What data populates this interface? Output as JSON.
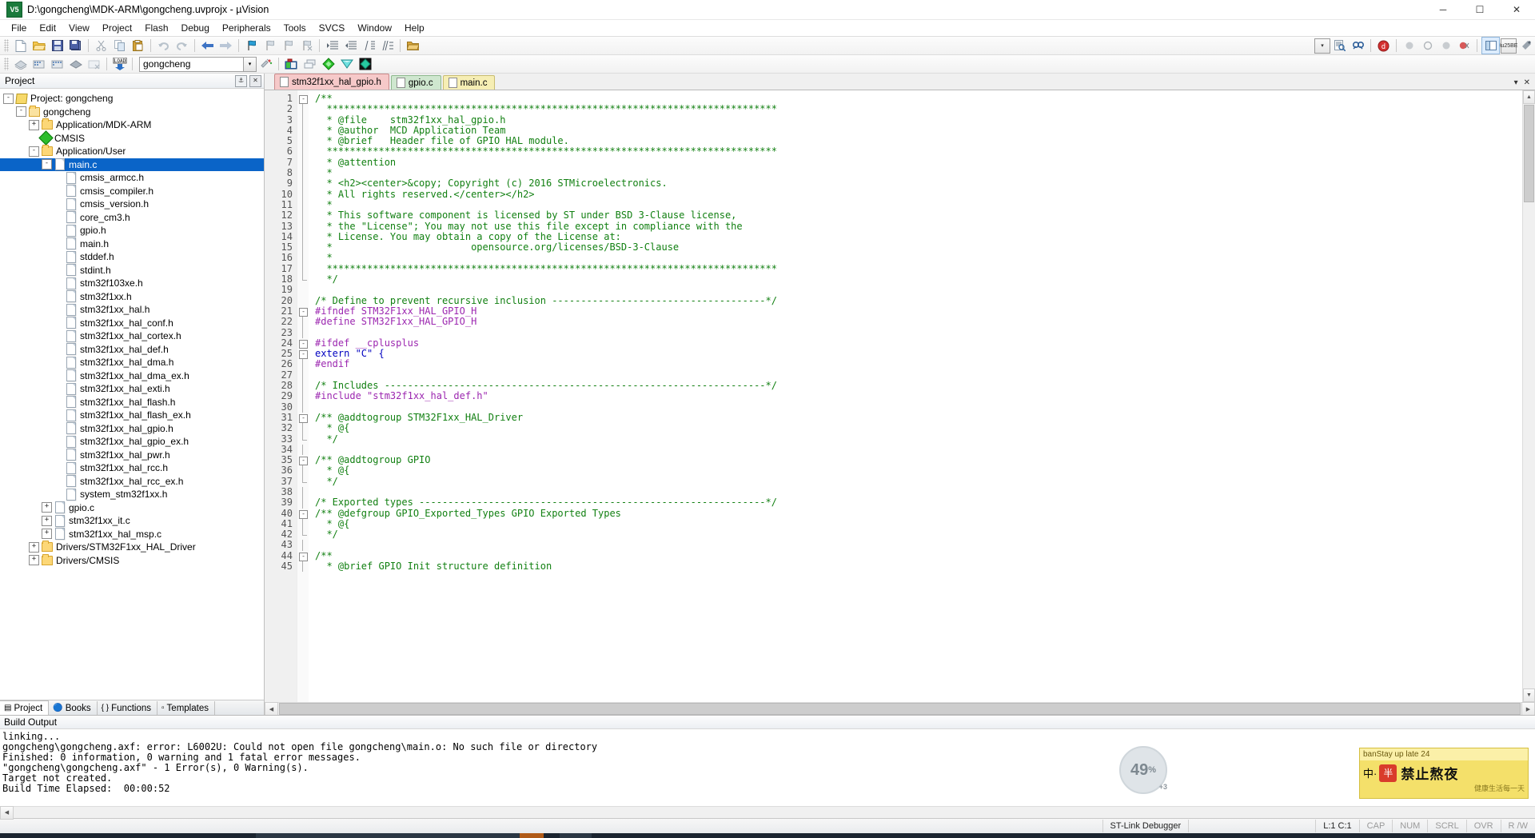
{
  "window": {
    "title": "D:\\gongcheng\\MDK-ARM\\gongcheng.uvprojx - µVision",
    "app_icon_text": "V5",
    "minimize": "─",
    "maximize": "☐",
    "close": "✕"
  },
  "menu": [
    "File",
    "Edit",
    "View",
    "Project",
    "Flash",
    "Debug",
    "Peripherals",
    "Tools",
    "SVCS",
    "Window",
    "Help"
  ],
  "toolbar_main": [
    {
      "name": "new-file-icon",
      "glyph": "📄"
    },
    {
      "name": "open-file-icon",
      "glyph": "📂"
    },
    {
      "name": "save-icon",
      "glyph": "💾"
    },
    {
      "name": "save-all-icon",
      "glyph": "🖫"
    },
    {
      "name": "cut-icon",
      "glyph": "✂"
    },
    {
      "name": "copy-icon",
      "glyph": "⧉"
    },
    {
      "name": "paste-icon",
      "glyph": "📋"
    },
    {
      "name": "undo-icon",
      "glyph": "↶"
    },
    {
      "name": "redo-icon",
      "glyph": "↷"
    },
    {
      "name": "navigate-back-icon",
      "glyph": "←"
    },
    {
      "name": "navigate-forward-icon",
      "glyph": "→"
    },
    {
      "name": "bookmark-toggle-icon",
      "glyph": "⚑"
    },
    {
      "name": "bookmark-prev-icon",
      "glyph": "⚑"
    },
    {
      "name": "bookmark-next-icon",
      "glyph": "⚑"
    },
    {
      "name": "bookmark-clear-icon",
      "glyph": "⚑"
    },
    {
      "name": "indent-right-icon",
      "glyph": "≡"
    },
    {
      "name": "indent-left-icon",
      "glyph": "≡"
    },
    {
      "name": "comment-lines-icon",
      "glyph": "⫽"
    },
    {
      "name": "uncomment-lines-icon",
      "glyph": "⫽"
    },
    {
      "name": "open-folder-icon",
      "glyph": "📁"
    }
  ],
  "toolbar_main_right": [
    {
      "name": "find-combo-dropdown-icon",
      "glyph": "▾"
    },
    {
      "name": "find-in-files-icon",
      "glyph": "🔍"
    },
    {
      "name": "incremental-find-icon",
      "glyph": "🔎"
    },
    {
      "name": "debug-session-icon",
      "glyph": "ⓓ"
    },
    {
      "name": "insert-breakpoint-icon",
      "glyph": "⬤"
    },
    {
      "name": "disable-breakpoint-icon",
      "glyph": "○"
    },
    {
      "name": "disable-all-breakpoints-icon",
      "glyph": "⬤"
    },
    {
      "name": "kill-all-breakpoints-icon",
      "glyph": "⬤"
    },
    {
      "name": "window-layout-icon",
      "glyph": "▣"
    },
    {
      "name": "configuration-wizard-icon",
      "glyph": "🔧"
    }
  ],
  "toolbar_build": [
    {
      "name": "translate-file-icon",
      "glyph": "◆"
    },
    {
      "name": "build-target-icon",
      "glyph": "▓"
    },
    {
      "name": "rebuild-all-icon",
      "glyph": "▓"
    },
    {
      "name": "batch-build-icon",
      "glyph": "◆"
    },
    {
      "name": "stop-build-icon",
      "glyph": "░"
    },
    {
      "name": "download-to-flash-icon",
      "glyph": "LOAD"
    }
  ],
  "toolbar_build_right": [
    {
      "name": "target-options-icon",
      "glyph": "⚙"
    },
    {
      "name": "manage-project-items-icon",
      "glyph": "❖"
    },
    {
      "name": "multi-project-icon",
      "glyph": "❐"
    },
    {
      "name": "pack-installer-icon",
      "glyph": "◆"
    },
    {
      "name": "manage-run-time-env-icon",
      "glyph": "▽"
    },
    {
      "name": "select-software-packs-icon",
      "glyph": "◈"
    }
  ],
  "target_selector": {
    "value": "gongcheng",
    "dropdown_icon": "▾"
  },
  "project_panel": {
    "title": "Project",
    "pin_icon": "⚓",
    "close_icon": "✕",
    "tabs": [
      {
        "label": "Project",
        "icon": "▤",
        "active": true
      },
      {
        "label": "Books",
        "icon": "🔵",
        "active": false
      },
      {
        "label": "Functions",
        "icon": "{ }",
        "active": false
      },
      {
        "label": "Templates",
        "icon": "▫",
        "active": false
      }
    ],
    "tree": [
      {
        "label": "Project: gongcheng",
        "depth": 0,
        "toggle": "-",
        "icon": "project",
        "selected": false
      },
      {
        "label": "gongcheng",
        "depth": 1,
        "toggle": "-",
        "icon": "folder-target",
        "selected": false
      },
      {
        "label": "Application/MDK-ARM",
        "depth": 2,
        "toggle": "+",
        "icon": "folder",
        "selected": false
      },
      {
        "label": "CMSIS",
        "depth": 2,
        "toggle": "",
        "icon": "diamond",
        "selected": false
      },
      {
        "label": "Application/User",
        "depth": 2,
        "toggle": "-",
        "icon": "folder",
        "selected": false
      },
      {
        "label": "main.c",
        "depth": 3,
        "toggle": "-",
        "icon": "doc",
        "selected": true
      },
      {
        "label": "cmsis_armcc.h",
        "depth": 4,
        "toggle": "",
        "icon": "doc",
        "selected": false
      },
      {
        "label": "cmsis_compiler.h",
        "depth": 4,
        "toggle": "",
        "icon": "doc",
        "selected": false
      },
      {
        "label": "cmsis_version.h",
        "depth": 4,
        "toggle": "",
        "icon": "doc",
        "selected": false
      },
      {
        "label": "core_cm3.h",
        "depth": 4,
        "toggle": "",
        "icon": "doc",
        "selected": false
      },
      {
        "label": "gpio.h",
        "depth": 4,
        "toggle": "",
        "icon": "doc",
        "selected": false
      },
      {
        "label": "main.h",
        "depth": 4,
        "toggle": "",
        "icon": "doc",
        "selected": false
      },
      {
        "label": "stddef.h",
        "depth": 4,
        "toggle": "",
        "icon": "doc",
        "selected": false
      },
      {
        "label": "stdint.h",
        "depth": 4,
        "toggle": "",
        "icon": "doc",
        "selected": false
      },
      {
        "label": "stm32f103xe.h",
        "depth": 4,
        "toggle": "",
        "icon": "doc",
        "selected": false
      },
      {
        "label": "stm32f1xx.h",
        "depth": 4,
        "toggle": "",
        "icon": "doc",
        "selected": false
      },
      {
        "label": "stm32f1xx_hal.h",
        "depth": 4,
        "toggle": "",
        "icon": "doc",
        "selected": false
      },
      {
        "label": "stm32f1xx_hal_conf.h",
        "depth": 4,
        "toggle": "",
        "icon": "doc",
        "selected": false
      },
      {
        "label": "stm32f1xx_hal_cortex.h",
        "depth": 4,
        "toggle": "",
        "icon": "doc",
        "selected": false
      },
      {
        "label": "stm32f1xx_hal_def.h",
        "depth": 4,
        "toggle": "",
        "icon": "doc",
        "selected": false
      },
      {
        "label": "stm32f1xx_hal_dma.h",
        "depth": 4,
        "toggle": "",
        "icon": "doc",
        "selected": false
      },
      {
        "label": "stm32f1xx_hal_dma_ex.h",
        "depth": 4,
        "toggle": "",
        "icon": "doc",
        "selected": false
      },
      {
        "label": "stm32f1xx_hal_exti.h",
        "depth": 4,
        "toggle": "",
        "icon": "doc",
        "selected": false
      },
      {
        "label": "stm32f1xx_hal_flash.h",
        "depth": 4,
        "toggle": "",
        "icon": "doc",
        "selected": false
      },
      {
        "label": "stm32f1xx_hal_flash_ex.h",
        "depth": 4,
        "toggle": "",
        "icon": "doc",
        "selected": false
      },
      {
        "label": "stm32f1xx_hal_gpio.h",
        "depth": 4,
        "toggle": "",
        "icon": "doc",
        "selected": false
      },
      {
        "label": "stm32f1xx_hal_gpio_ex.h",
        "depth": 4,
        "toggle": "",
        "icon": "doc",
        "selected": false
      },
      {
        "label": "stm32f1xx_hal_pwr.h",
        "depth": 4,
        "toggle": "",
        "icon": "doc",
        "selected": false
      },
      {
        "label": "stm32f1xx_hal_rcc.h",
        "depth": 4,
        "toggle": "",
        "icon": "doc",
        "selected": false
      },
      {
        "label": "stm32f1xx_hal_rcc_ex.h",
        "depth": 4,
        "toggle": "",
        "icon": "doc",
        "selected": false
      },
      {
        "label": "system_stm32f1xx.h",
        "depth": 4,
        "toggle": "",
        "icon": "doc",
        "selected": false
      },
      {
        "label": "gpio.c",
        "depth": 3,
        "toggle": "+",
        "icon": "doc",
        "selected": false
      },
      {
        "label": "stm32f1xx_it.c",
        "depth": 3,
        "toggle": "+",
        "icon": "doc",
        "selected": false
      },
      {
        "label": "stm32f1xx_hal_msp.c",
        "depth": 3,
        "toggle": "+",
        "icon": "doc",
        "selected": false
      },
      {
        "label": "Drivers/STM32F1xx_HAL_Driver",
        "depth": 2,
        "toggle": "+",
        "icon": "folder",
        "selected": false
      },
      {
        "label": "Drivers/CMSIS",
        "depth": 2,
        "toggle": "+",
        "icon": "folder",
        "selected": false
      }
    ]
  },
  "editor": {
    "tabs": [
      {
        "label": "stm32f1xx_hal_gpio.h",
        "color": "red",
        "active": true
      },
      {
        "label": "gpio.c",
        "color": "green",
        "active": false
      },
      {
        "label": "main.c",
        "color": "yellow",
        "active": false
      }
    ],
    "tab_controls": {
      "scroll_left": "▾",
      "close": "✕"
    },
    "first_line_number": 1,
    "lines": [
      {
        "n": 1,
        "fold": "-",
        "text": "/**",
        "cls": "c-cmt"
      },
      {
        "n": 2,
        "fold": "|",
        "text": "  ******************************************************************************",
        "cls": "c-cmt"
      },
      {
        "n": 3,
        "fold": "|",
        "text": "  * @file    stm32f1xx_hal_gpio.h",
        "cls": "c-cmt"
      },
      {
        "n": 4,
        "fold": "|",
        "text": "  * @author  MCD Application Team",
        "cls": "c-cmt"
      },
      {
        "n": 5,
        "fold": "|",
        "text": "  * @brief   Header file of GPIO HAL module.",
        "cls": "c-cmt"
      },
      {
        "n": 6,
        "fold": "|",
        "text": "  ******************************************************************************",
        "cls": "c-cmt"
      },
      {
        "n": 7,
        "fold": "|",
        "text": "  * @attention",
        "cls": "c-cmt"
      },
      {
        "n": 8,
        "fold": "|",
        "text": "  *",
        "cls": "c-cmt"
      },
      {
        "n": 9,
        "fold": "|",
        "text": "  * <h2><center>&copy; Copyright (c) 2016 STMicroelectronics.",
        "cls": "c-cmt"
      },
      {
        "n": 10,
        "fold": "|",
        "text": "  * All rights reserved.</center></h2>",
        "cls": "c-cmt"
      },
      {
        "n": 11,
        "fold": "|",
        "text": "  *",
        "cls": "c-cmt"
      },
      {
        "n": 12,
        "fold": "|",
        "text": "  * This software component is licensed by ST under BSD 3-Clause license,",
        "cls": "c-cmt"
      },
      {
        "n": 13,
        "fold": "|",
        "text": "  * the \"License\"; You may not use this file except in compliance with the",
        "cls": "c-cmt"
      },
      {
        "n": 14,
        "fold": "|",
        "text": "  * License. You may obtain a copy of the License at:",
        "cls": "c-cmt"
      },
      {
        "n": 15,
        "fold": "|",
        "text": "  *                        opensource.org/licenses/BSD-3-Clause",
        "cls": "c-cmt"
      },
      {
        "n": 16,
        "fold": "|",
        "text": "  *",
        "cls": "c-cmt"
      },
      {
        "n": 17,
        "fold": "|",
        "text": "  ******************************************************************************",
        "cls": "c-cmt"
      },
      {
        "n": 18,
        "fold": "L",
        "text": "  */",
        "cls": "c-cmt"
      },
      {
        "n": 19,
        "fold": "",
        "text": "",
        "cls": "c-txt"
      },
      {
        "n": 20,
        "fold": "",
        "text": "/* Define to prevent recursive inclusion -------------------------------------*/",
        "cls": "c-cmt"
      },
      {
        "n": 21,
        "fold": "-",
        "text": "#ifndef STM32F1xx_HAL_GPIO_H",
        "cls": "c-pre"
      },
      {
        "n": 22,
        "fold": "|",
        "text": "#define STM32F1xx_HAL_GPIO_H",
        "cls": "c-pre"
      },
      {
        "n": 23,
        "fold": "|",
        "text": "",
        "cls": "c-txt"
      },
      {
        "n": 24,
        "fold": "-",
        "text": "#ifdef __cplusplus",
        "cls": "c-pre"
      },
      {
        "n": 25,
        "fold": "-",
        "text": "extern \"C\" {",
        "cls": "c-kw"
      },
      {
        "n": 26,
        "fold": "|",
        "text": "#endif",
        "cls": "c-pre"
      },
      {
        "n": 27,
        "fold": "|",
        "text": "",
        "cls": "c-txt"
      },
      {
        "n": 28,
        "fold": "|",
        "text": "/* Includes ------------------------------------------------------------------*/",
        "cls": "c-cmt"
      },
      {
        "n": 29,
        "fold": "|",
        "text": "#include \"stm32f1xx_hal_def.h\"",
        "cls": "c-pre"
      },
      {
        "n": 30,
        "fold": "|",
        "text": "",
        "cls": "c-txt"
      },
      {
        "n": 31,
        "fold": "-",
        "text": "/** @addtogroup STM32F1xx_HAL_Driver",
        "cls": "c-cmt"
      },
      {
        "n": 32,
        "fold": "|",
        "text": "  * @{",
        "cls": "c-cmt"
      },
      {
        "n": 33,
        "fold": "L",
        "text": "  */",
        "cls": "c-cmt"
      },
      {
        "n": 34,
        "fold": "|",
        "text": "",
        "cls": "c-txt"
      },
      {
        "n": 35,
        "fold": "-",
        "text": "/** @addtogroup GPIO",
        "cls": "c-cmt"
      },
      {
        "n": 36,
        "fold": "|",
        "text": "  * @{",
        "cls": "c-cmt"
      },
      {
        "n": 37,
        "fold": "L",
        "text": "  */",
        "cls": "c-cmt"
      },
      {
        "n": 38,
        "fold": "|",
        "text": "",
        "cls": "c-txt"
      },
      {
        "n": 39,
        "fold": "|",
        "text": "/* Exported types ------------------------------------------------------------*/",
        "cls": "c-cmt"
      },
      {
        "n": 40,
        "fold": "-",
        "text": "/** @defgroup GPIO_Exported_Types GPIO Exported Types",
        "cls": "c-cmt"
      },
      {
        "n": 41,
        "fold": "|",
        "text": "  * @{",
        "cls": "c-cmt"
      },
      {
        "n": 42,
        "fold": "L",
        "text": "  */",
        "cls": "c-cmt"
      },
      {
        "n": 43,
        "fold": "|",
        "text": "",
        "cls": "c-txt"
      },
      {
        "n": 44,
        "fold": "-",
        "text": "/**",
        "cls": "c-cmt"
      },
      {
        "n": 45,
        "fold": "|",
        "text": "  * @brief GPIO Init structure definition",
        "cls": "c-cmt"
      }
    ]
  },
  "build_output": {
    "title": "Build Output",
    "lines": [
      "linking...",
      "gongcheng\\gongcheng.axf: error: L6002U: Could not open file gongcheng\\main.o: No such file or directory",
      "Finished: 0 information, 0 warning and 1 fatal error messages.",
      "\"gongcheng\\gongcheng.axf\" - 1 Error(s), 0 Warning(s).",
      "Target not created.",
      "Build Time Elapsed:  00:00:52"
    ]
  },
  "floating": {
    "score_badge": "49",
    "score_badge_suffix": "%",
    "score_badge_plus": "+3",
    "ad_top_text": "banStay up late 24",
    "ad_icon": "半",
    "ad_main_text": "禁止熬夜",
    "ad_sub_text": "健康生活每一天",
    "ad_prefix": "中·"
  },
  "status_bar": {
    "left": "",
    "debugger": "ST-Link Debugger",
    "position": "L:1 C:1",
    "cells": [
      "CAP",
      "NUM",
      "SCRL",
      "OVR",
      "R /W"
    ]
  },
  "colors": {
    "selection": "#0a64c8",
    "comment": "#128012",
    "preprocessor": "#9c27b0",
    "keyword": "#0000c0",
    "string": "#1a1aff",
    "error_panel_bg": "#ffffff",
    "tab_active": "#f6c9c9"
  }
}
